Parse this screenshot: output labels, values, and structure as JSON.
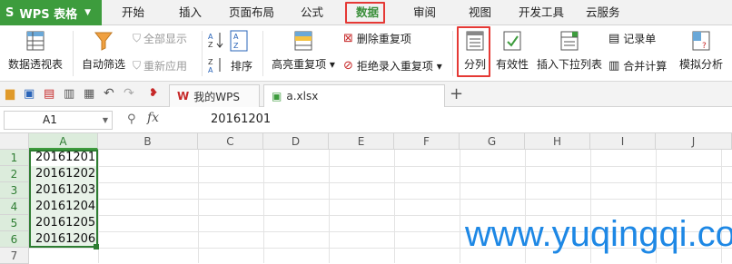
{
  "app": {
    "name": "WPS 表格",
    "logo": "S"
  },
  "ribbon_tabs": [
    "开始",
    "插入",
    "页面布局",
    "公式",
    "数据",
    "审阅",
    "视图",
    "开发工具",
    "云服务"
  ],
  "active_tab": "数据",
  "ribbon": {
    "pivot": "数据透视表",
    "autofilter": "自动筛选",
    "show_all": "全部显示",
    "reapply": "重新应用",
    "sort": "排序",
    "highlight_dup": "高亮重复项",
    "remove_dup": "删除重复项",
    "reject_dup": "拒绝录入重复项",
    "text_to_columns": "分列",
    "validity": "有效性",
    "dropdown_list": "插入下拉列表",
    "record_form": "记录单",
    "consolidate": "合并计算",
    "what_if": "模拟分析"
  },
  "doc_tabs": [
    {
      "label": "我的WPS",
      "icon": "wps-icon"
    },
    {
      "label": "a.xlsx",
      "icon": "xlsx-icon"
    }
  ],
  "add_tab": "+",
  "name_box": "A1",
  "fx": "fx",
  "formula_value": "20161201",
  "columns": [
    "A",
    "B",
    "C",
    "D",
    "E",
    "F",
    "G",
    "H",
    "I",
    "J"
  ],
  "rows": [
    "1",
    "2",
    "3",
    "4",
    "5",
    "6",
    "7"
  ],
  "cells_A": [
    "20161201",
    "20161202",
    "20161203",
    "20161204",
    "20161205",
    "20161206"
  ],
  "watermark": "www.yuqingqi.com",
  "colors": {
    "brand_green": "#3d9c3d",
    "highlight_red": "#e53935",
    "watermark_blue": "#1e88e5"
  }
}
